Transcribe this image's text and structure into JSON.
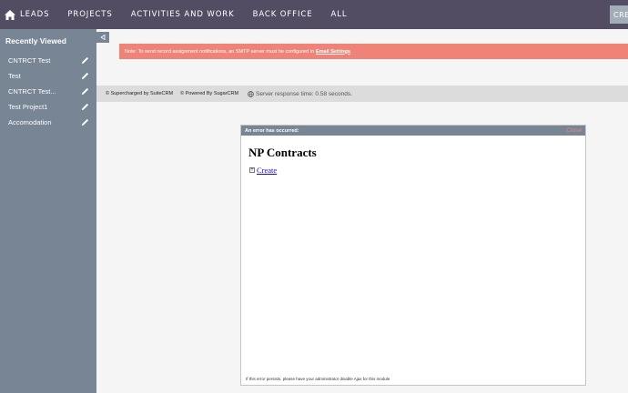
{
  "nav": {
    "items": [
      "LEADS",
      "PROJECTS",
      "ACTIVITIES AND WORK",
      "BACK OFFICE",
      "ALL"
    ],
    "create_label": "CRE"
  },
  "sidebar": {
    "title": "Recently Viewed",
    "items": [
      {
        "label": "CNTRCT Test"
      },
      {
        "label": "Test"
      },
      {
        "label": "CNTRCT Test..."
      },
      {
        "label": "Test Project1"
      },
      {
        "label": "Accomodation"
      }
    ]
  },
  "notice": {
    "text": "Note: To send record assignment notifications, an SMTP server must be configured in",
    "link": "Email Settings",
    "end": "."
  },
  "footer": {
    "supercharged": "© Supercharged by SuiteCRM",
    "powered": "© Powered By SugarCRM",
    "response": "Server response time: 0.58 seconds."
  },
  "dialog": {
    "header": "An error has occurred:",
    "close": "Close",
    "heading": "NP Contracts",
    "create_link": "Create",
    "footer_note": "If this error persists, please have your administrator disable Ajax for this module"
  },
  "colors": {
    "topnav": "#534d64",
    "sidebar": "#788595",
    "notice": "#f08377",
    "create_button": "#a3adb8"
  }
}
